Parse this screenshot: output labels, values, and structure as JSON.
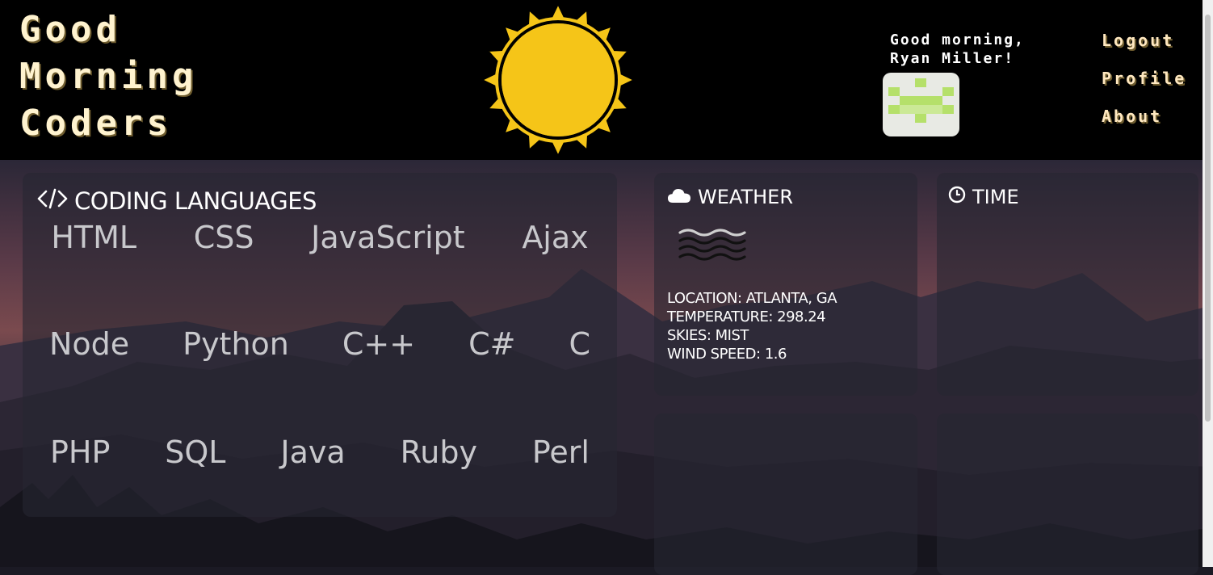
{
  "header": {
    "title_lines": [
      "Good",
      "Morning",
      "Coders"
    ],
    "greeting_lines": [
      "Good morning,",
      "Ryan Miller!"
    ],
    "sun_icon": "sun-icon",
    "avatar_icon": "pixel-avatar-icon",
    "nav": {
      "logout": "Logout",
      "profile": "Profile",
      "about": "About"
    }
  },
  "coding": {
    "title": "CODING LANGUAGES",
    "icon": "code-icon",
    "row1": [
      "HTML",
      "CSS",
      "JavaScript",
      "Ajax"
    ],
    "row2": [
      "Node",
      "Python",
      "C++",
      "C#",
      "C"
    ],
    "row3": [
      "PHP",
      "SQL",
      "Java",
      "Ruby",
      "Perl"
    ]
  },
  "weather": {
    "title": "WEATHER",
    "icon": "cloud-icon",
    "condition_icon": "mist-icon",
    "location": "LOCATION: ATLANTA, GA",
    "temperature": "TEMPERATURE: 298.24",
    "skies": "SKIES: MIST",
    "wind": "WIND SPEED: 1.6"
  },
  "time": {
    "title": "TIME",
    "icon": "clock-icon"
  },
  "colors": {
    "sun": "#f5c518",
    "header_bg": "#000000",
    "title_text": "#fff3cf",
    "avatar_green": "#b5e06a"
  }
}
